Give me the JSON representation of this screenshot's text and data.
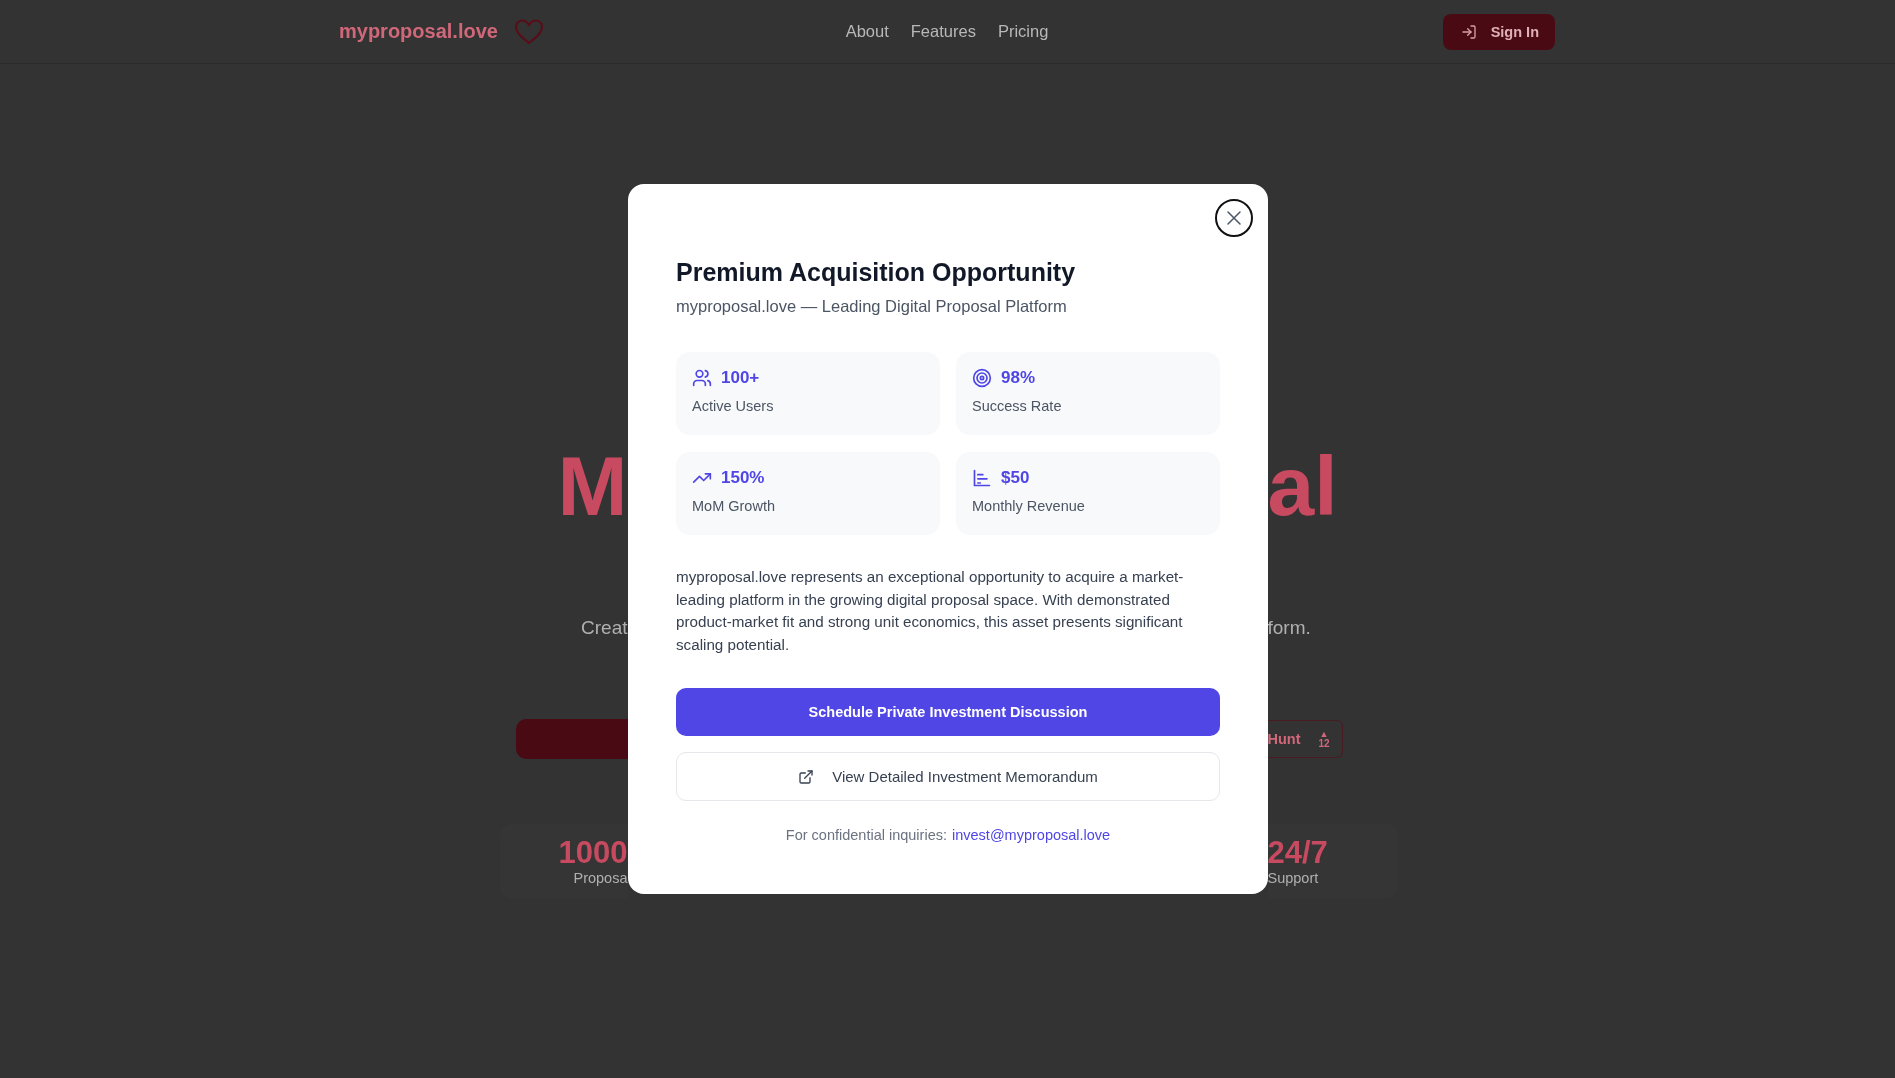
{
  "header": {
    "logo": "myproposal.love",
    "nav": [
      {
        "label": "About"
      },
      {
        "label": "Features"
      },
      {
        "label": "Pricing"
      }
    ],
    "sign_in": "Sign In"
  },
  "hero": {
    "heading_left": "M",
    "heading_right": "al",
    "subtitle_left": "Creat",
    "subtitle_right": "form.",
    "badge_text": "Hunt",
    "badge_arrow": "▲",
    "badge_votes": "12",
    "stat_left": {
      "value": "1000",
      "label": "Proposa"
    },
    "stat_right": {
      "value": "24/7",
      "label": "Support"
    }
  },
  "modal": {
    "title": "Premium Acquisition Opportunity",
    "subtitle": "myproposal.love — Leading Digital Proposal Platform",
    "metrics": [
      {
        "kind": "users",
        "value": "100+",
        "label": "Active Users"
      },
      {
        "kind": "target",
        "value": "98%",
        "label": "Success Rate"
      },
      {
        "kind": "trend",
        "value": "150%",
        "label": "MoM Growth"
      },
      {
        "kind": "chart",
        "value": "$50",
        "label": "Monthly Revenue"
      }
    ],
    "description": "myproposal.love represents an exceptional opportunity to acquire a market-leading platform in the growing digital proposal space. With demonstrated product-market fit and strong unit economics, this asset presents significant scaling potential.",
    "primary_button": "Schedule Private Investment Discussion",
    "secondary_button": "View Detailed Investment Memorandum",
    "footer": {
      "text": "For confidential inquiries:",
      "link": "invest@myproposal.love"
    }
  }
}
